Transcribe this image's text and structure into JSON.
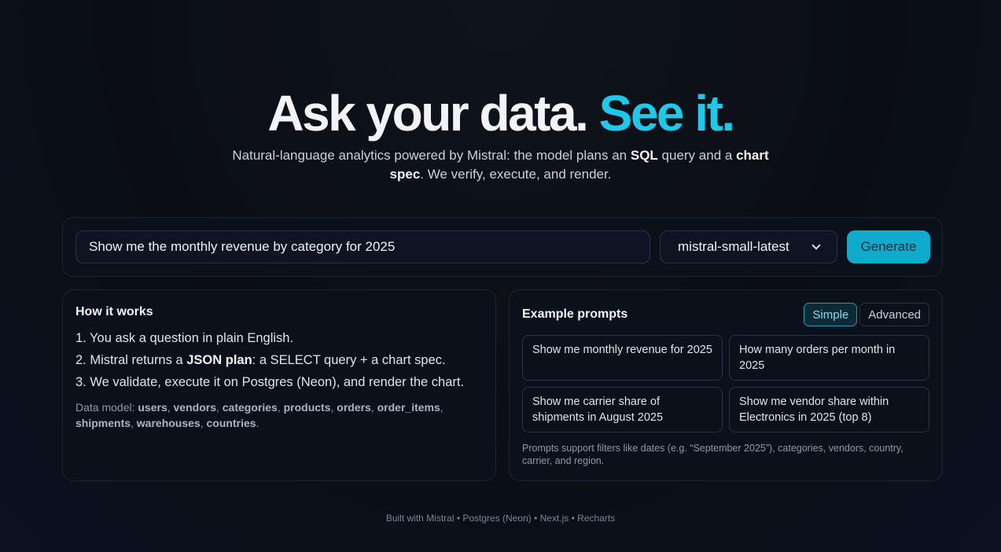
{
  "hero": {
    "title_main": "Ask your data.",
    "title_accent": "See it.",
    "sub_1": "Natural-language analytics powered by Mistral: the model plans an ",
    "sub_b1": "SQL",
    "sub_2": " query and a ",
    "sub_b2": "chart spec",
    "sub_3": ". We verify, execute, and render."
  },
  "query": {
    "value": "Show me the monthly revenue by category for 2025",
    "model": "mistral-small-latest",
    "generate_label": "Generate"
  },
  "how": {
    "title": "How it works",
    "step1": "1. You ask a question in plain English.",
    "step2_a": "2. Mistral returns a ",
    "step2_b": "JSON plan",
    "step2_c": ": a SELECT query + a chart spec.",
    "step3": "3. We validate, execute it on Postgres (Neon), and render the chart.",
    "dm_label": "Data model: ",
    "tables": [
      "users",
      "vendors",
      "categories",
      "products",
      "orders",
      "order_items",
      "shipments",
      "warehouses",
      "countries"
    ]
  },
  "examples": {
    "title": "Example prompts",
    "tab_simple": "Simple",
    "tab_advanced": "Advanced",
    "prompts": [
      "Show me monthly revenue for 2025",
      "How many orders per month in 2025",
      "Show me carrier share of shipments in August 2025",
      "Show me vendor share within Electronics in 2025 (top 8)"
    ],
    "hint": "Prompts support filters like dates (e.g. “September 2025”), categories, vendors, country, carrier, and region."
  },
  "footer": "Built with Mistral • Postgres (Neon) • Next.js • Recharts"
}
